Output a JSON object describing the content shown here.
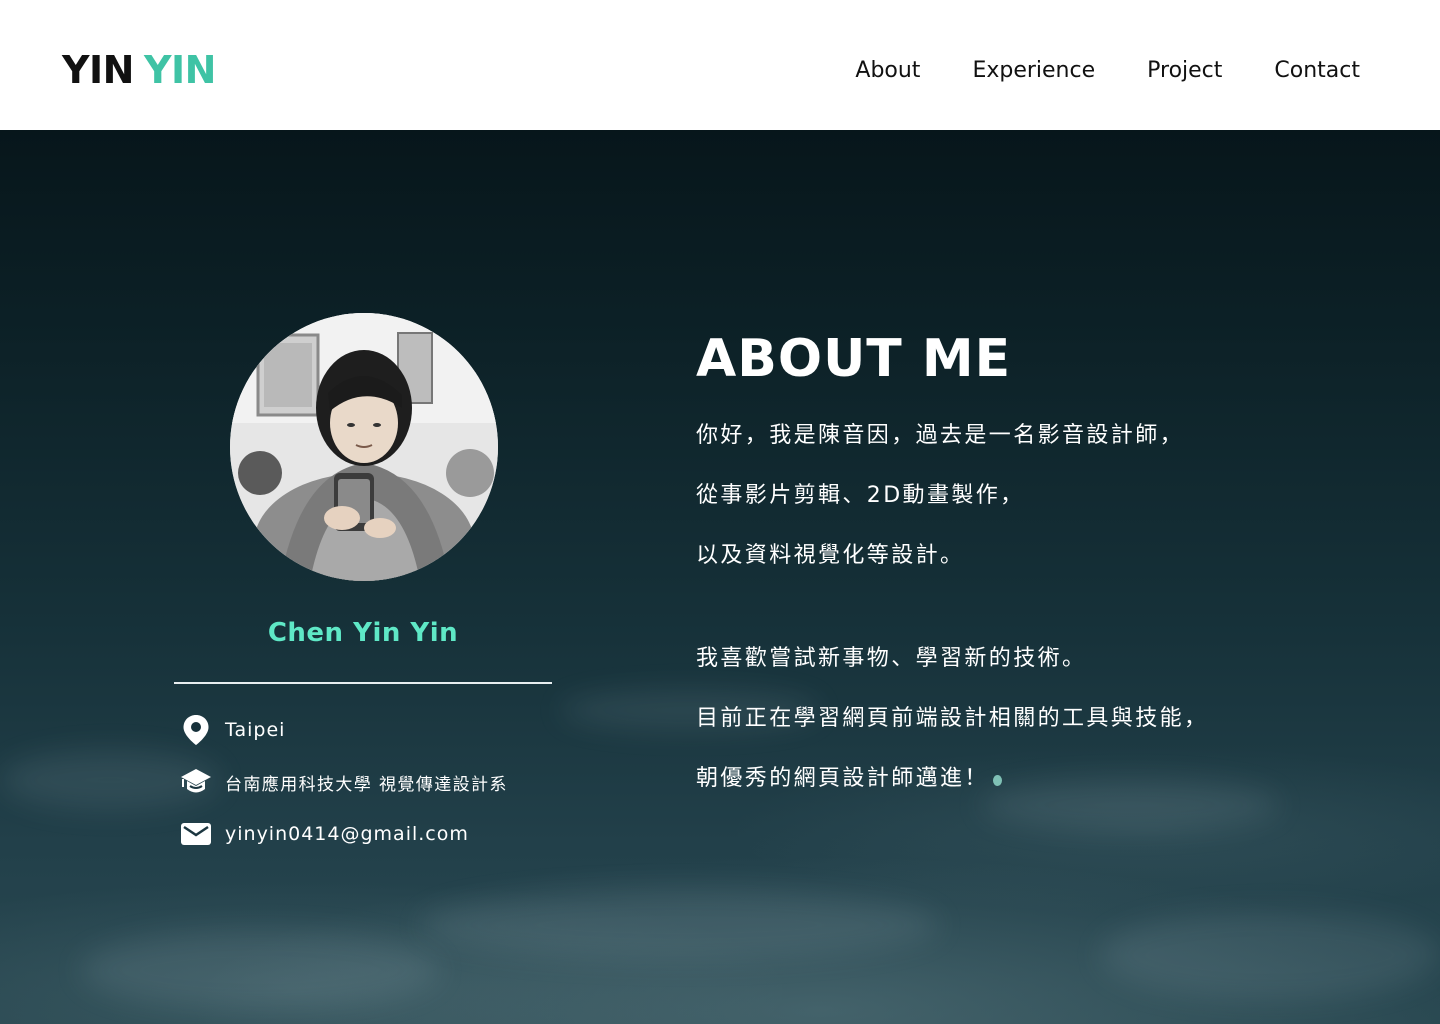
{
  "brand": {
    "logo_first": "YIN",
    "logo_second": "YIN",
    "accent_color": "#3fc3a5"
  },
  "nav": {
    "items": [
      {
        "label": "About"
      },
      {
        "label": "Experience"
      },
      {
        "label": "Project"
      },
      {
        "label": "Contact"
      }
    ]
  },
  "profile": {
    "avatar_icon": "profile-photo",
    "name": "Chen Yin Yin",
    "name_color": "#5fe8c6",
    "location": {
      "icon": "location-pin-icon",
      "text": "Taipei"
    },
    "education": {
      "icon": "graduation-cap-icon",
      "text": "台南應用科技大學  視覺傳達設計系"
    },
    "email": {
      "icon": "mail-icon",
      "text": "yinyin0414@gmail.com"
    }
  },
  "about": {
    "title": "ABOUT ME",
    "paragraph1": [
      "你好，我是陳音因，過去是一名影音設計師，",
      "從事影片剪輯、2D動畫製作，",
      "以及資料視覺化等設計。"
    ],
    "paragraph2": [
      "我喜歡嘗試新事物、學習新的技術。",
      "目前正在學習網頁前端設計相關的工具與技能，",
      "朝優秀的網頁設計師邁進！"
    ]
  }
}
